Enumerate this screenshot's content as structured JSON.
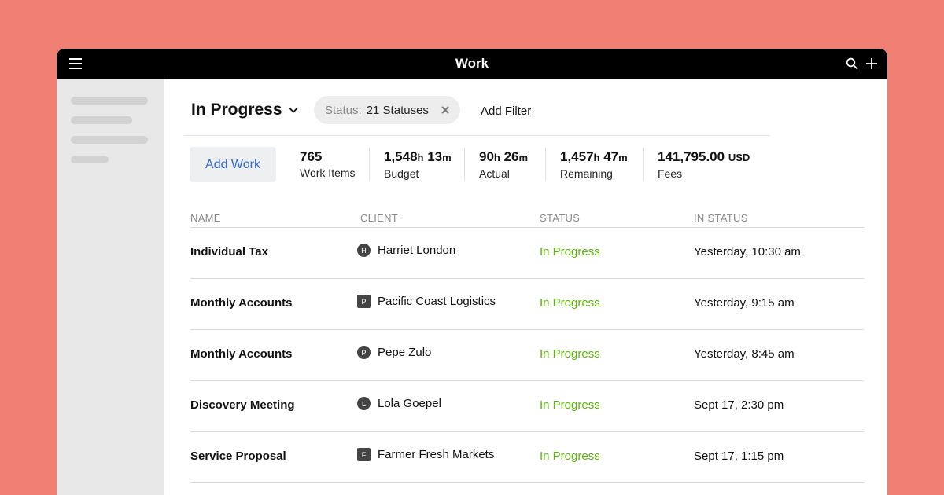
{
  "app": {
    "title": "Work"
  },
  "header": {
    "view_title": "In Progress",
    "filter_label": "Status:",
    "filter_value": "21 Statuses",
    "add_filter": "Add Filter"
  },
  "toolbar": {
    "add_work_label": "Add Work"
  },
  "stats": [
    {
      "value": "765",
      "unit": "",
      "label": "Work Items"
    },
    {
      "value_parts": [
        "1,548",
        "h",
        " 13",
        "m"
      ],
      "label": "Budget"
    },
    {
      "value_parts": [
        "90",
        "h",
        " 26",
        "m"
      ],
      "label": "Actual"
    },
    {
      "value_parts": [
        "1,457",
        "h",
        " 47",
        "m"
      ],
      "label": "Remaining"
    },
    {
      "value": "141,795.00",
      "unit": "USD",
      "label": "Fees"
    }
  ],
  "table": {
    "columns": [
      "NAME",
      "CLIENT",
      "STATUS",
      "IN STATUS"
    ],
    "rows": [
      {
        "name": "Individual Tax",
        "client": "Harriet London",
        "initial": "H",
        "avatar_shape": "circle",
        "status": "In Progress",
        "in_status": "Yesterday, 10:30 am"
      },
      {
        "name": "Monthly Accounts",
        "client": "Pacific Coast Logistics",
        "initial": "P",
        "avatar_shape": "square",
        "status": "In Progress",
        "in_status": "Yesterday, 9:15 am"
      },
      {
        "name": "Monthly Accounts",
        "client": "Pepe Zulo",
        "initial": "P",
        "avatar_shape": "circle",
        "status": "In Progress",
        "in_status": "Yesterday, 8:45 am"
      },
      {
        "name": "Discovery Meeting",
        "client": "Lola Goepel",
        "initial": "L",
        "avatar_shape": "circle",
        "status": "In Progress",
        "in_status": "Sept 17, 2:30 pm"
      },
      {
        "name": "Service Proposal",
        "client": "Farmer Fresh Markets",
        "initial": "F",
        "avatar_shape": "square",
        "status": "In Progress",
        "in_status": "Sept 17, 1:15 pm"
      }
    ]
  },
  "colors": {
    "background": "#EF7F72",
    "topbar": "#000000",
    "accent_link": "#2F67D8",
    "status_green": "#5CB30A",
    "sidebar": "#E8E8E8"
  },
  "icons": [
    "menu-icon",
    "search-icon",
    "plus-icon",
    "chevron-down-icon",
    "close-icon"
  ]
}
